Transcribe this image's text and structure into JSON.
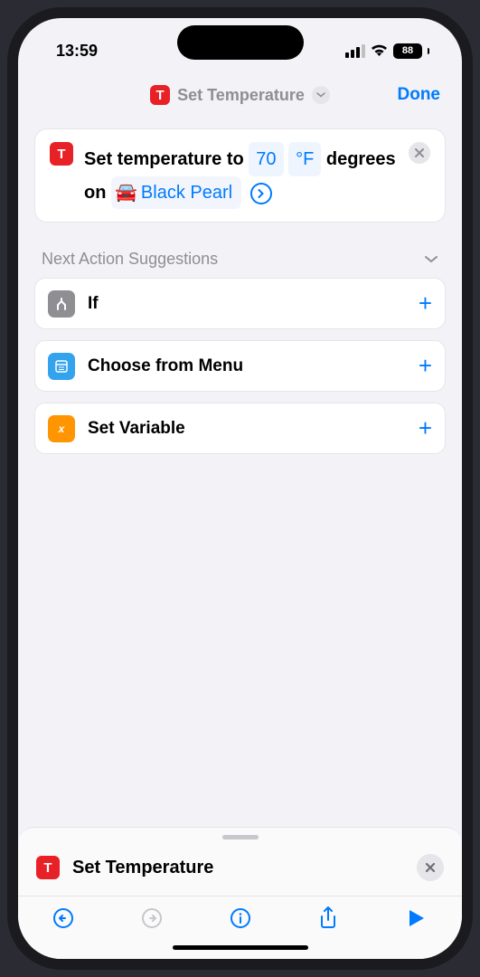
{
  "status": {
    "time": "13:59",
    "battery": "88"
  },
  "nav": {
    "title": "Set Temperature",
    "done": "Done"
  },
  "action": {
    "prefix": "Set temperature to ",
    "value": "70",
    "unit": "°F",
    "middle": " degrees on ",
    "car_name": "Black Pearl"
  },
  "suggestions": {
    "header": "Next Action Suggestions",
    "items": [
      {
        "label": "If"
      },
      {
        "label": "Choose from Menu"
      },
      {
        "label": "Set Variable"
      }
    ]
  },
  "panel": {
    "title": "Set Temperature"
  }
}
